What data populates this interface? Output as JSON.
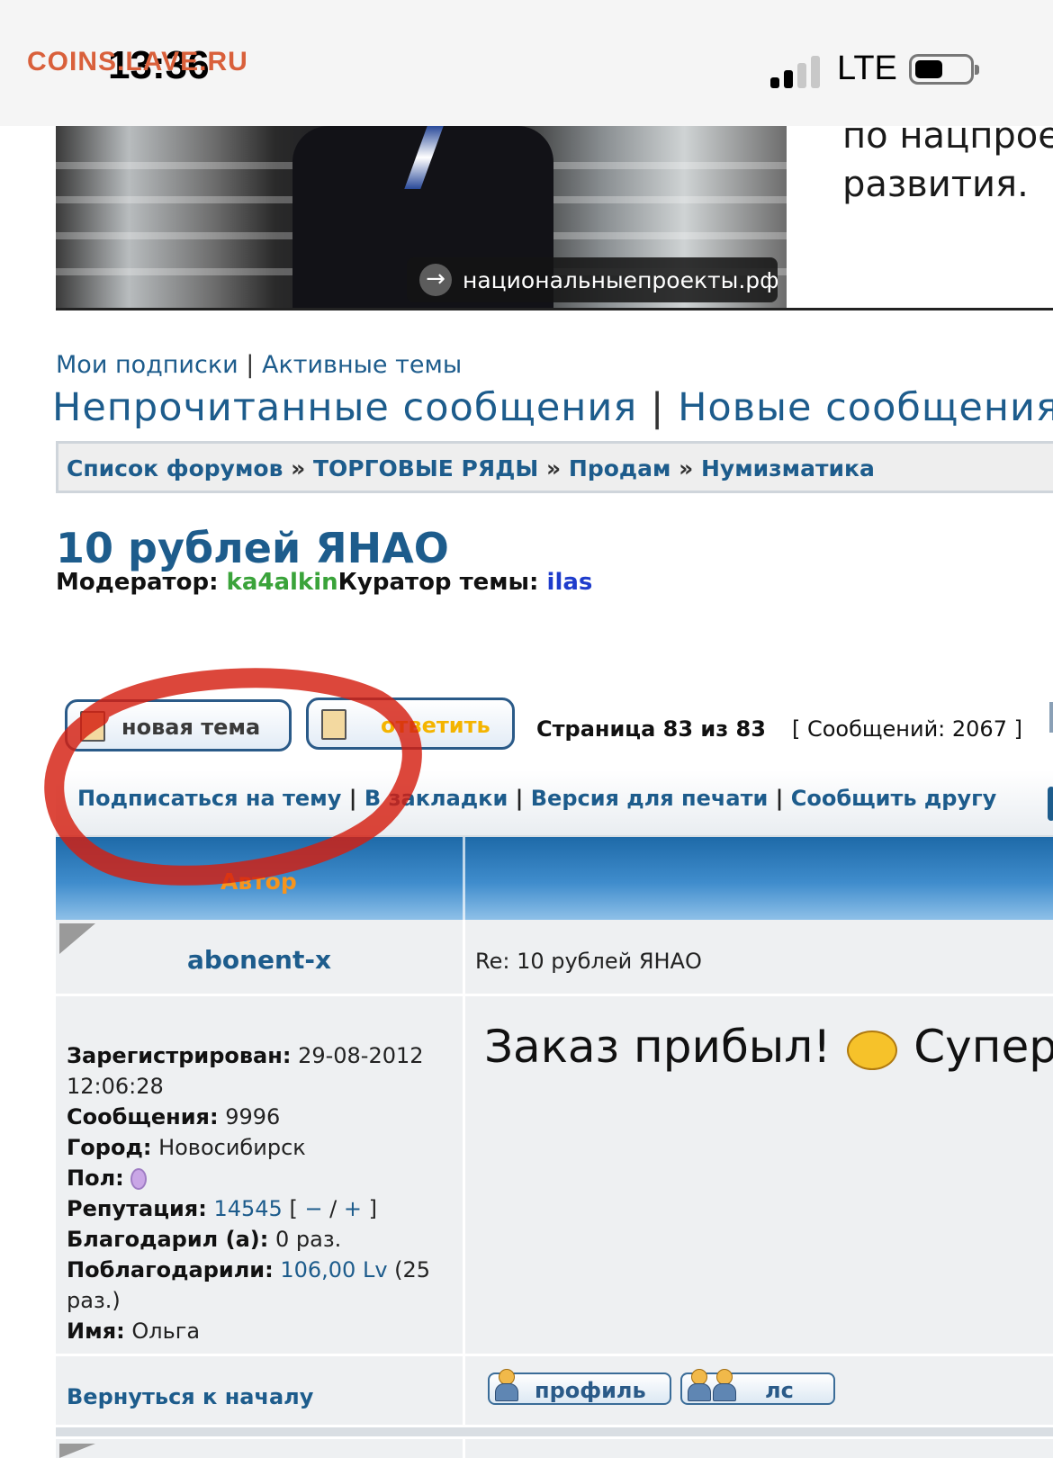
{
  "status_bar": {
    "watermark": "COINS.LAVE.RU",
    "time": "13:36",
    "network": "LTE",
    "signal_bars": 4,
    "signal_bars_active": 2
  },
  "ad": {
    "link_text": "национальныепроекты.рф",
    "line1": "по нацпрое",
    "line2": "развития."
  },
  "nav": {
    "my_subscriptions": "Мои подписки",
    "active_topics": "Активные темы",
    "unread_messages": "Непрочитанные сообщения",
    "new_messages": "Новые сообщения",
    "separator": "|"
  },
  "breadcrumb": {
    "items": [
      "Список форумов",
      "ТОРГОВЫЕ РЯДЫ",
      "Продам",
      "Нумизматика"
    ],
    "separator": "»"
  },
  "topic": {
    "title": "10 рублей ЯНАО",
    "moderator_label": "Модератор:",
    "moderator_name": "ka4alkin",
    "curator_label": "Куратор темы:",
    "curator_name": "ilas"
  },
  "actions": {
    "new_topic": "новая тема",
    "reply": "ответить",
    "page_label": "Страница 83 из 83",
    "messages_count": "[ Сообщений: 2067 ]"
  },
  "topic_bar": {
    "subscribe": "Подписаться на тему",
    "bookmarks": "В закладки",
    "print_version": "Версия для печати",
    "tell_friend": "Сообщить другу"
  },
  "table": {
    "author_header": "Автор"
  },
  "post": {
    "author": "abonent-x",
    "subject": "Re: 10 рублей ЯНАО",
    "body_part1": "Заказ прибыл!",
    "body_part2": "Супер",
    "smiley_icon": "smiley-icon",
    "profile": {
      "registered_label": "Зарегистрирован:",
      "registered_value": "29-08-2012 12:06:28",
      "messages_label": "Сообщения:",
      "messages_value": "9996",
      "city_label": "Город:",
      "city_value": "Новосибирск",
      "gender_label": "Пол:",
      "gender_icon": "female-icon",
      "reputation_label": "Репутация:",
      "reputation_value": "14545",
      "reputation_minus": "−",
      "reputation_plus": "+",
      "thanked_label": "Благодарил (а):",
      "thanked_value": "0 раз.",
      "was_thanked_label": "Поблагодарили:",
      "was_thanked_value": "106,00 Lv",
      "was_thanked_times": "(25 раз.)",
      "name_label": "Имя:",
      "name_value": "Ольга"
    },
    "back_to_top": "Вернуться к началу",
    "profile_button": "профиль",
    "pm_button": "лс"
  },
  "colors": {
    "link": "#1d5c8c",
    "header_accent": "#f7941d",
    "moderator": "#3aa33a",
    "curator": "#1e3ccc",
    "annotation_red": "#d41e10"
  }
}
